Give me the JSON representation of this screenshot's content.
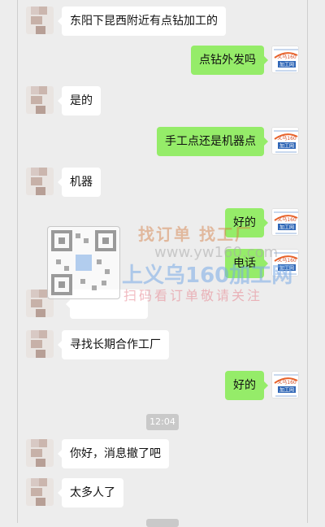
{
  "messages": [
    {
      "side": "left",
      "text": "东阳下昆西附近有点钻加工的"
    },
    {
      "side": "right",
      "text": "点钻外发吗"
    },
    {
      "side": "left",
      "text": "是的"
    },
    {
      "side": "right",
      "text": "手工点还是机器点"
    },
    {
      "side": "left",
      "text": "机器"
    },
    {
      "side": "right",
      "text": "好的"
    },
    {
      "side": "right",
      "text": "电话"
    },
    {
      "side": "left",
      "text": ""
    },
    {
      "side": "left",
      "text": "寻找长期合作工厂"
    },
    {
      "side": "right",
      "text": "好的"
    },
    {
      "side": "left",
      "text": "你好，消息撤了吧"
    },
    {
      "side": "left",
      "text": "太多人了"
    }
  ],
  "time_divider": "12:04",
  "watermark": {
    "title": "找订单 找工厂",
    "site": "www.yw160.com",
    "brand": "上义乌160加工网",
    "subtitle": "扫码看订单敬请关注"
  },
  "logo": {
    "text": "义乌160",
    "sub": "加工网"
  },
  "colors": {
    "background": "#ededed",
    "outgoing_bubble": "#95ec69",
    "incoming_bubble": "#ffffff",
    "time_pill": "#c9c9c9"
  }
}
